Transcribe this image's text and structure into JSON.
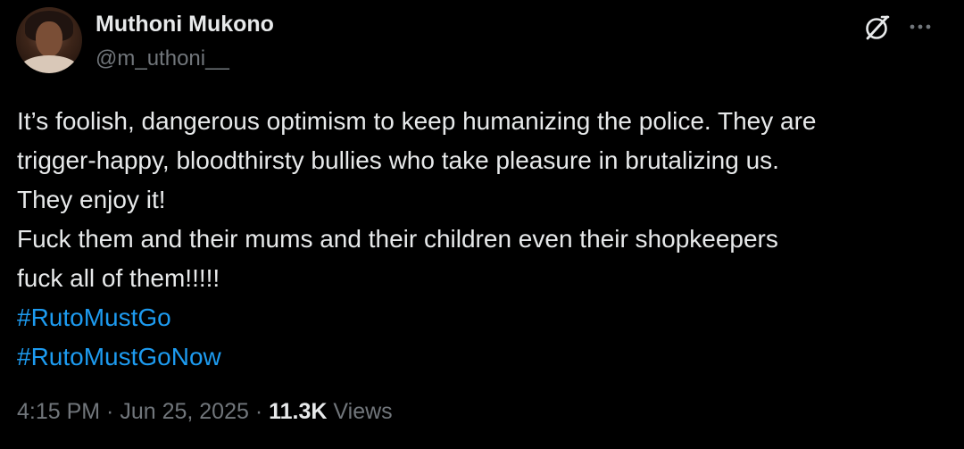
{
  "author": {
    "display_name": "Muthoni Mukono",
    "handle": "@m_uthoni__"
  },
  "header_icons": [
    "grok-icon",
    "more-options-icon"
  ],
  "post": {
    "lines": [
      "It’s foolish, dangerous optimism to keep humanizing the police. They are",
      "trigger-happy, bloodthirsty bullies who take pleasure in brutalizing us.",
      "They enjoy it!",
      "Fuck them and their mums and their children even their shopkeepers",
      "fuck all of them!!!!!"
    ],
    "hashtags": [
      "#RutoMustGo",
      "#RutoMustGoNow"
    ]
  },
  "meta": {
    "time": "4:15 PM",
    "separator_1": " · ",
    "date": "Jun 25, 2025",
    "separator_2": " · ",
    "views_count": "11.3K",
    "views_label": " Views"
  },
  "colors": {
    "background": "#000000",
    "text": "#e7e9ea",
    "secondary": "#71767b",
    "link": "#1d9bf0"
  }
}
